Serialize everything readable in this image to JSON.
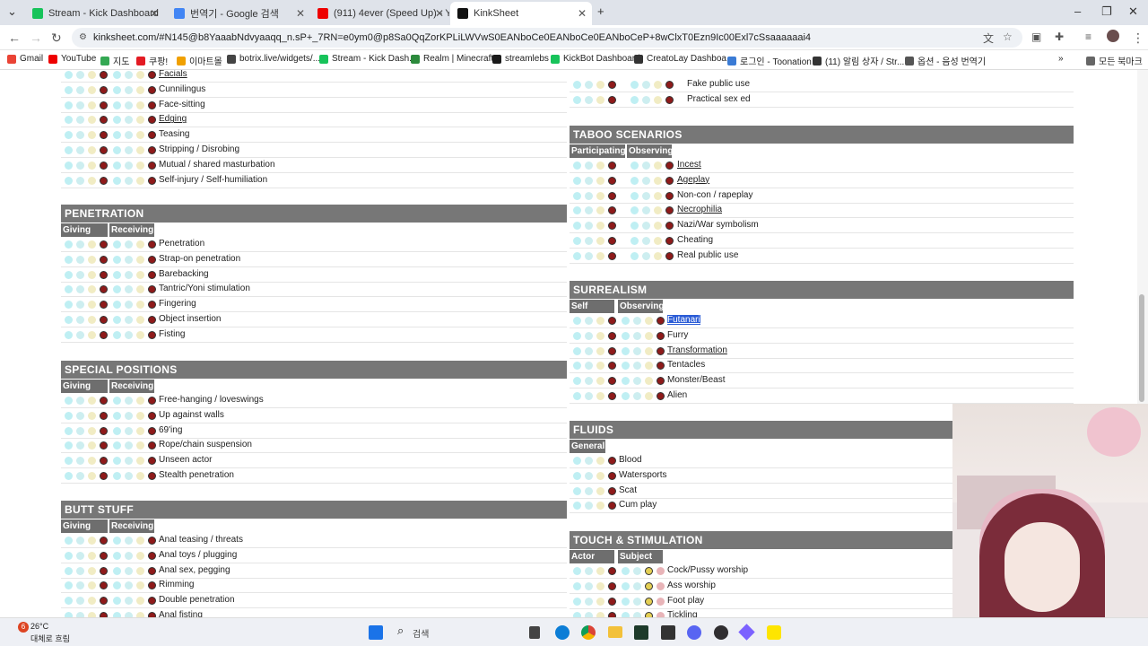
{
  "browser": {
    "tabs": [
      {
        "title": "Stream - Kick Dashboard",
        "color": "#17c35a"
      },
      {
        "title": "번역기 - Google 검색",
        "color": "#4285f4"
      },
      {
        "title": "(911) 4ever (Speed Up) - Y",
        "color": "#e00"
      },
      {
        "title": "KinkSheet",
        "color": "#111"
      }
    ],
    "url": "kinksheet.com/#N145@b8YaaabNdvyaaqq_n.sP+_7RN=e0ym0@p8Sa0QqZorKPLiLWVwS0EANboCe0EANboCe0EANboCeP+8wClxT0Ezn9Ic00Exl7cSsaaaaaai4",
    "bookmarks": [
      "Gmail",
      "YouTube",
      "지도",
      "쿠팡!",
      "이마트몰",
      "botrix.live/widgets/...",
      "Stream - Kick Dash...",
      "Realm | Minecraft",
      "streamlebs",
      "KickBot Dashboard",
      "CreatoLay Dashboa...",
      "로그인 - Toonation",
      "(11) 알림 상자 / Str...",
      "옵션 - 음성 번역기"
    ],
    "bookmark_folder": "모든 북마크"
  },
  "sheet": {
    "partial_left": {
      "items": [
        "Facials",
        "Cunnilingus",
        "Face-sitting",
        "Edging",
        "Teasing",
        "Stripping / Disrobing",
        "Mutual / shared masturbation",
        "Self-injury / Self-humiliation"
      ]
    },
    "partial_right": {
      "items": [
        "Fake public use",
        "Practical sex ed"
      ]
    },
    "categories": [
      {
        "title": "PENETRATION",
        "subs": [
          "Giving",
          "Receiving"
        ],
        "items": [
          "Penetration",
          "Strap-on penetration",
          "Barebacking",
          "Tantric/Yoni stimulation",
          "Fingering",
          "Object insertion",
          "Fisting"
        ]
      },
      {
        "title": "SPECIAL POSITIONS",
        "subs": [
          "Giving",
          "Receiving"
        ],
        "items": [
          "Free-hanging / loveswings",
          "Up against walls",
          "69'ing",
          "Rope/chain suspension",
          "Unseen actor",
          "Stealth penetration"
        ]
      },
      {
        "title": "BUTT STUFF",
        "subs": [
          "Giving",
          "Receiving"
        ],
        "items": [
          "Anal teasing / threats",
          "Anal toys / plugging",
          "Anal sex, pegging",
          "Rimming",
          "Double penetration",
          "Anal fisting"
        ]
      },
      {
        "title": "TABOO SCENARIOS",
        "subs": [
          "Participating",
          "Observing"
        ],
        "items": [
          "Incest",
          "Ageplay",
          "Non-con / rapeplay",
          "Necrophilia",
          "Nazi/War symbolism",
          "Cheating",
          "Real public use"
        ]
      },
      {
        "title": "SURREALISM",
        "subs": [
          "Self",
          "Observing"
        ],
        "items": [
          "Futanari",
          "Furry",
          "Transformation",
          "Tentacles",
          "Monster/Beast",
          "Alien"
        ]
      },
      {
        "title": "FLUIDS",
        "subs": [
          "General"
        ],
        "items": [
          "Blood",
          "Watersports",
          "Scat",
          "Cum play"
        ]
      },
      {
        "title": "TOUCH & STIMULATION",
        "subs": [
          "Actor",
          "Subject"
        ],
        "items": [
          "Cock/Pussy worship",
          "Ass worship",
          "Foot play",
          "Tickling"
        ]
      }
    ],
    "colors": {
      "header": "#777777",
      "sub": "#6e6e6e",
      "not_entered": "#ffffff",
      "favorite": "#6db6f5",
      "like": "#23b000",
      "okay": "#fdb813",
      "maybe": "#db6c00",
      "no": "#920000"
    }
  },
  "taskbar": {
    "weather_temp": "26°C",
    "weather_desc": "대체로 흐림",
    "search": "검색",
    "badge": "6"
  }
}
